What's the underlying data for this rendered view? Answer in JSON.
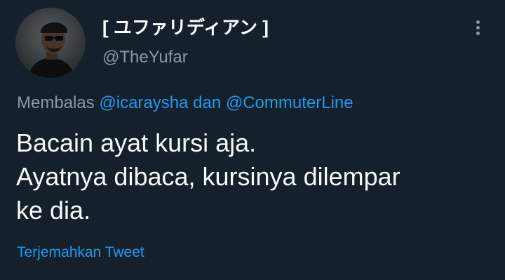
{
  "author": {
    "display_name": "[ ユファリディアン ]",
    "handle": "@TheYufar",
    "avatar_icon": "profile-photo"
  },
  "reply": {
    "prefix": "Membalas",
    "mention_1": "@icaraysha",
    "conjunction": "dan",
    "mention_2": "@CommuterLine"
  },
  "tweet": {
    "lines": [
      "Bacain ayat kursi aja.",
      "Ayatnya dibaca, kursinya dilempar",
      "ke dia."
    ]
  },
  "actions": {
    "translate_label": "Terjemahkan Tweet",
    "more_icon": "more-vertical-icon"
  },
  "colors": {
    "background": "#15202b",
    "accent": "#1d9bf0",
    "secondary_text": "#8b98a5",
    "primary_text": "#f7f9f9"
  }
}
